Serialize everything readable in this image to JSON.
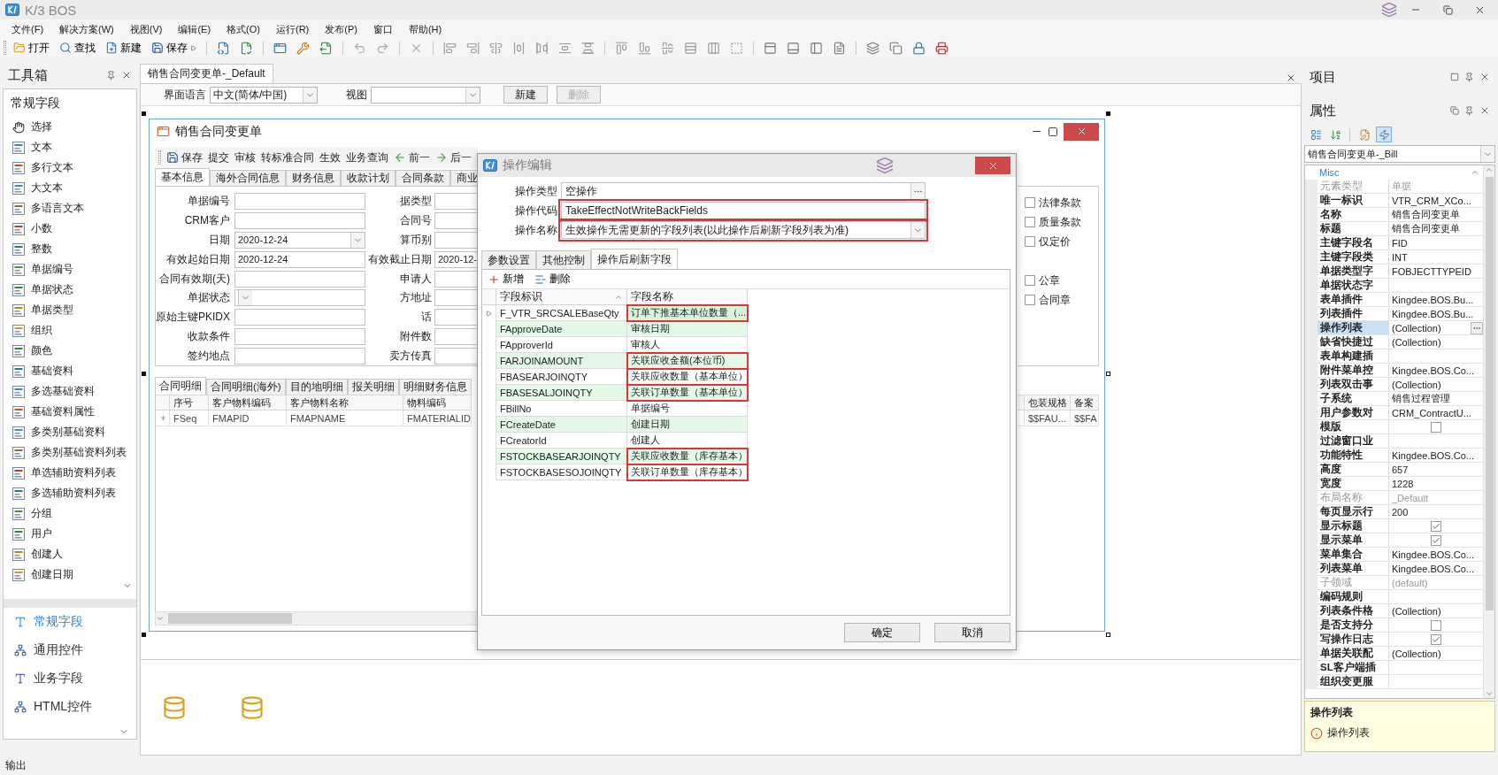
{
  "window": {
    "title": "K/3 BOS"
  },
  "menu": [
    "文件(F)",
    "解决方案(W)",
    "视图(V)",
    "编辑(E)",
    "格式(O)",
    "运行(R)",
    "发布(P)",
    "窗口",
    "帮助(H)"
  ],
  "toolbar": {
    "buttons": [
      "打开",
      "查找",
      "新建",
      "保存"
    ]
  },
  "toolbox": {
    "title": "工具箱",
    "group": "常规字段",
    "items": [
      "选择",
      "文本",
      "多行文本",
      "大文本",
      "多语言文本",
      "小数",
      "整数",
      "单据编号",
      "单据状态",
      "单据类型",
      "组织",
      "颜色",
      "基础资料",
      "多选基础资料",
      "基础资料属性",
      "多类别基础资料",
      "多类别基础资料列表",
      "单选辅助资料列表",
      "多选辅助资料列表",
      "分组",
      "用户",
      "创建人",
      "创建日期"
    ],
    "categories": [
      {
        "label": "常规字段",
        "selected": true
      },
      {
        "label": "通用控件",
        "selected": false
      },
      {
        "label": "业务字段",
        "selected": false
      },
      {
        "label": "HTML控件",
        "selected": false
      }
    ]
  },
  "document_tab": {
    "title": "销售合同变更单-_Default"
  },
  "view_bar": {
    "language_label": "界面语言",
    "language_value": "中文(简体/中国)",
    "view_label": "视图",
    "buttons": [
      {
        "label": "新建",
        "disabled": false
      },
      {
        "label": "删除",
        "disabled": true
      }
    ]
  },
  "form": {
    "title": "销售合同变更单",
    "toolbar": [
      "保存",
      "提交",
      "审核",
      "转标准合同",
      "生效",
      "业务查询",
      "前一",
      "后一"
    ],
    "tabs": [
      {
        "label": "基本信息",
        "selected": true
      },
      {
        "label": "海外合同信息",
        "selected": false
      },
      {
        "label": "财务信息",
        "selected": false
      },
      {
        "label": "收款计划",
        "selected": false
      },
      {
        "label": "合同条款",
        "selected": false
      },
      {
        "label": "商业",
        "selected": false
      }
    ],
    "fields": [
      {
        "label": "单据编号",
        "kind": "text"
      },
      {
        "label": "CRM客户",
        "kind": "text"
      },
      {
        "label": "日期",
        "value": "2020-12-24",
        "kind": "combo"
      },
      {
        "label": "有效起始日期",
        "value": "2020-12-24",
        "kind": "text"
      },
      {
        "label": "合同有效期(天)",
        "kind": "text"
      },
      {
        "label": "单据状态",
        "kind": "combo"
      },
      {
        "label": "原始主键PKIDX",
        "kind": "text"
      },
      {
        "label": "收款条件",
        "kind": "text"
      },
      {
        "label": "签约地点",
        "kind": "text"
      }
    ],
    "side_fields": [
      {
        "label": "据类型"
      },
      {
        "label": "合同号"
      },
      {
        "label": "算币别"
      },
      {
        "label": "有效截止日期",
        "value": "2020-12-"
      },
      {
        "label": "申请人"
      },
      {
        "label": "方地址"
      },
      {
        "label": "话"
      },
      {
        "label": "附件数"
      },
      {
        "label": "卖方传真"
      }
    ],
    "checkbox_groups": [
      [
        {
          "label": "法律条款",
          "checked": false
        },
        {
          "label": "质量条款",
          "checked": false
        },
        {
          "label": "仅定价",
          "checked": false
        }
      ],
      [
        {
          "label": "公章",
          "checked": false
        },
        {
          "label": "合同章",
          "checked": false
        }
      ]
    ],
    "detail_tabs": [
      {
        "label": "合同明细",
        "selected": true
      },
      {
        "label": "合同明细(海外)",
        "selected": false
      },
      {
        "label": "目的地明细",
        "selected": false
      },
      {
        "label": "报关明细",
        "selected": false
      },
      {
        "label": "明细财务信息",
        "selected": false
      }
    ],
    "grid": {
      "columns": [
        "序号",
        "客户物料编码",
        "客户物料名称",
        "物料编码"
      ],
      "rows": [
        [
          "FSeq",
          "FMAPID",
          "FMAPNAME",
          "FMATERIALID"
        ]
      ]
    },
    "grid_right": {
      "columns": [
        "包装规格",
        "备案"
      ],
      "rows": [
        [
          "$$FAU...",
          "$$FA"
        ]
      ]
    }
  },
  "dialog": {
    "title": "操作编辑",
    "fields": [
      {
        "label": "操作类型",
        "value": "空操作",
        "kind": "lookup",
        "flagged": false
      },
      {
        "label": "操作代码",
        "value": "TakeEffectNotWriteBackFields",
        "kind": "text",
        "flagged": true
      },
      {
        "label": "操作名称",
        "value": "生效操作无需更新的字段列表(以此操作后刷新字段列表为准)",
        "kind": "combo",
        "flagged": true
      }
    ],
    "tabs": [
      {
        "label": "参数设置",
        "selected": false
      },
      {
        "label": "其他控制",
        "selected": false
      },
      {
        "label": "操作后刷新字段",
        "selected": true
      }
    ],
    "toolbar": [
      "新增",
      "删除"
    ],
    "grid": {
      "columns": [
        {
          "label": "字段标识",
          "sorted": true
        },
        {
          "label": "字段名称",
          "sorted": false
        }
      ],
      "rows": [
        {
          "id": "F_VTR_SRCSALEBaseQty",
          "name": "订单下推基本单位数量（...",
          "current": true,
          "flagged": true
        },
        {
          "id": "FApproveDate",
          "name": "审核日期",
          "current": false,
          "flagged": false
        },
        {
          "id": "FApproverId",
          "name": "审核人",
          "current": false,
          "flagged": false
        },
        {
          "id": "FARJOINAMOUNT",
          "name": "关联应收金额(本位币)",
          "current": false,
          "flagged": true
        },
        {
          "id": "FBASEARJOINQTY",
          "name": "关联应收数量（基本单位）",
          "current": false,
          "flagged": true
        },
        {
          "id": "FBASESALJOINQTY",
          "name": "关联订单数量（基本单位）",
          "current": false,
          "flagged": true
        },
        {
          "id": "FBillNo",
          "name": "单据编号",
          "current": false,
          "flagged": false
        },
        {
          "id": "FCreateDate",
          "name": "创建日期",
          "current": false,
          "flagged": false
        },
        {
          "id": "FCreatorId",
          "name": "创建人",
          "current": false,
          "flagged": false
        },
        {
          "id": "FSTOCKBASEARJOINQTY",
          "name": "关联应收数量（库存基本）",
          "current": false,
          "flagged": true
        },
        {
          "id": "FSTOCKBASESOJOINQTY",
          "name": "关联订单数量（库存基本）",
          "current": false,
          "flagged": true
        }
      ]
    },
    "buttons": [
      "确定",
      "取消"
    ]
  },
  "project_panel": {
    "title": "项目"
  },
  "properties": {
    "title": "属性",
    "object": "销售合同变更单-_Bill",
    "category": "Misc",
    "rows": [
      {
        "name": "元素类型",
        "value": "单据",
        "kind": "text",
        "readonly": true,
        "selected": false
      },
      {
        "name": "唯一标识",
        "value": "VTR_CRM_XCo...",
        "kind": "text",
        "readonly": false,
        "selected": false
      },
      {
        "name": "名称",
        "value": "销售合同变更单",
        "kind": "text",
        "readonly": false,
        "selected": false
      },
      {
        "name": "标题",
        "value": "销售合同变更单",
        "kind": "text",
        "readonly": false,
        "selected": false
      },
      {
        "name": "主键字段名",
        "value": "FID",
        "kind": "text",
        "readonly": false,
        "selected": false
      },
      {
        "name": "主键字段类",
        "value": "INT",
        "kind": "text",
        "readonly": false,
        "selected": false
      },
      {
        "name": "单据类型字",
        "value": "FOBJECTTYPEID",
        "kind": "text",
        "readonly": false,
        "selected": false
      },
      {
        "name": "单据状态字",
        "kind": "text",
        "readonly": false,
        "selected": false
      },
      {
        "name": "表单插件",
        "value": "Kingdee.BOS.Bu...",
        "kind": "text",
        "readonly": false,
        "selected": false
      },
      {
        "name": "列表插件",
        "value": "Kingdee.BOS.Bu...",
        "kind": "text",
        "readonly": false,
        "selected": false
      },
      {
        "name": "操作列表",
        "value": "(Collection)",
        "kind": "text",
        "readonly": false,
        "selected": true
      },
      {
        "name": "缺省快捷过",
        "value": "(Collection)",
        "kind": "text",
        "readonly": false,
        "selected": false
      },
      {
        "name": "表单构建插",
        "kind": "text",
        "readonly": false,
        "selected": false
      },
      {
        "name": "附件菜单控",
        "value": "Kingdee.BOS.Co...",
        "kind": "text",
        "readonly": false,
        "selected": false
      },
      {
        "name": "列表双击事",
        "value": "(Collection)",
        "kind": "text",
        "readonly": false,
        "selected": false
      },
      {
        "name": "子系统",
        "value": "销售过程管理",
        "kind": "text",
        "readonly": false,
        "selected": false
      },
      {
        "name": "用户参数对",
        "value": "CRM_ContractU...",
        "kind": "text",
        "readonly": false,
        "selected": false
      },
      {
        "name": "模版",
        "kind": "check",
        "checked": false,
        "readonly": false,
        "selected": false
      },
      {
        "name": "过滤窗口业",
        "kind": "text",
        "readonly": false,
        "selected": false
      },
      {
        "name": "功能特性",
        "value": "Kingdee.BOS.Co...",
        "kind": "text",
        "readonly": false,
        "selected": false
      },
      {
        "name": "高度",
        "value": "657",
        "kind": "text",
        "readonly": false,
        "selected": false
      },
      {
        "name": "宽度",
        "value": "1228",
        "kind": "text",
        "readonly": false,
        "selected": false
      },
      {
        "name": "布局名称",
        "value": "_Default",
        "kind": "text",
        "readonly": true,
        "selected": false
      },
      {
        "name": "每页显示行",
        "value": "200",
        "kind": "text",
        "readonly": false,
        "selected": false
      },
      {
        "name": "显示标题",
        "kind": "check",
        "checked": true,
        "readonly": false,
        "selected": false
      },
      {
        "name": "显示菜单",
        "kind": "check",
        "checked": true,
        "readonly": false,
        "selected": false
      },
      {
        "name": "菜单集合",
        "value": "Kingdee.BOS.Co...",
        "kind": "text",
        "readonly": false,
        "selected": false
      },
      {
        "name": "列表菜单",
        "value": "Kingdee.BOS.Co...",
        "kind": "text",
        "readonly": false,
        "selected": false
      },
      {
        "name": "子领域",
        "value": "(default)",
        "kind": "text",
        "readonly": true,
        "selected": false
      },
      {
        "name": "编码规则",
        "kind": "text",
        "readonly": false,
        "selected": false
      },
      {
        "name": "列表条件格",
        "value": "(Collection)",
        "kind": "text",
        "readonly": false,
        "selected": false
      },
      {
        "name": "是否支持分",
        "kind": "check",
        "checked": false,
        "readonly": false,
        "selected": false
      },
      {
        "name": "写操作日志",
        "kind": "check",
        "checked": true,
        "readonly": false,
        "selected": false
      },
      {
        "name": "单据关联配",
        "value": "(Collection)",
        "kind": "text",
        "readonly": false,
        "selected": false
      },
      {
        "name": "SL客户端插",
        "kind": "text",
        "readonly": false,
        "selected": false
      },
      {
        "name": "组织变更服",
        "kind": "text",
        "readonly": false,
        "selected": false
      }
    ],
    "description": {
      "title": "操作列表",
      "text": "操作列表"
    }
  },
  "status_bar": {
    "label": "输出"
  }
}
